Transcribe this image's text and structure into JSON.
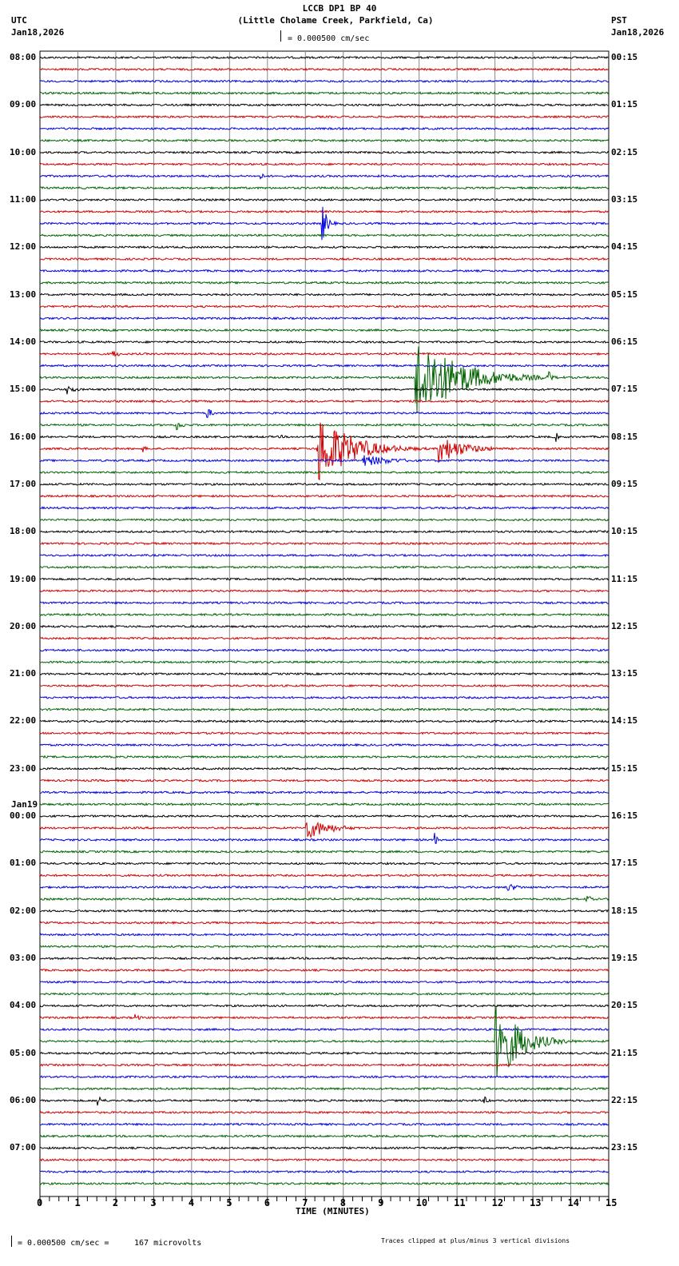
{
  "header": {
    "title": "LCCB DP1 BP 40",
    "subtitle": "(Little Cholame Creek, Parkfield, Ca)",
    "left_tz": "UTC",
    "left_date": "Jan18,2026",
    "right_tz": "PST",
    "right_date": "Jan18,2026",
    "scale": "= 0.000500 cm/sec"
  },
  "footer": {
    "scale": "= 0.000500 cm/sec =",
    "microvolts": "167 microvolts",
    "clip_note": "Traces clipped at plus/minus 3 vertical divisions"
  },
  "chart_data": {
    "type": "line",
    "title": "LCCB DP1 BP 40",
    "xlabel": "TIME (MINUTES)",
    "xlim": [
      0,
      15
    ],
    "x_ticks": [
      "0",
      "1",
      "2",
      "3",
      "4",
      "5",
      "6",
      "7",
      "8",
      "9",
      "10",
      "11",
      "12",
      "13",
      "14",
      "15"
    ],
    "trace_count": 96,
    "trace_minutes": 15,
    "trace_colors": [
      "#000000",
      "#d00000",
      "#0000e0",
      "#006400"
    ],
    "clip_divisions": 3,
    "date_change_label": "Jan19",
    "date_change_trace": 64,
    "left_labels": [
      "08:00",
      "09:00",
      "10:00",
      "11:00",
      "12:00",
      "13:00",
      "14:00",
      "15:00",
      "16:00",
      "17:00",
      "18:00",
      "19:00",
      "20:00",
      "21:00",
      "22:00",
      "23:00",
      "00:00",
      "01:00",
      "02:00",
      "03:00",
      "04:00",
      "05:00",
      "06:00",
      "07:00"
    ],
    "right_labels": [
      "00:15",
      "01:15",
      "02:15",
      "03:15",
      "04:15",
      "05:15",
      "06:15",
      "07:15",
      "08:15",
      "09:15",
      "10:15",
      "11:15",
      "12:15",
      "13:15",
      "14:15",
      "15:15",
      "16:15",
      "17:15",
      "18:15",
      "19:15",
      "20:15",
      "21:15",
      "22:15",
      "23:15"
    ],
    "events": [
      {
        "trace": 14,
        "minute": 7.4,
        "duration": 0.4,
        "amplitude": 1.8
      },
      {
        "trace": 10,
        "minute": 5.8,
        "duration": 0.3,
        "amplitude": 0.3
      },
      {
        "trace": 25,
        "minute": 1.9,
        "duration": 0.6,
        "amplitude": 0.3
      },
      {
        "trace": 27,
        "minute": 9.9,
        "duration": 3.2,
        "amplitude": 3.0
      },
      {
        "trace": 27,
        "minute": 13.4,
        "duration": 0.3,
        "amplitude": 0.6
      },
      {
        "trace": 28,
        "minute": 0.7,
        "duration": 0.6,
        "amplitude": 0.4
      },
      {
        "trace": 30,
        "minute": 4.4,
        "duration": 0.3,
        "amplitude": 0.6
      },
      {
        "trace": 31,
        "minute": 3.6,
        "duration": 0.5,
        "amplitude": 0.4
      },
      {
        "trace": 32,
        "minute": 6.3,
        "duration": 0.2,
        "amplitude": 0.4
      },
      {
        "trace": 32,
        "minute": 13.6,
        "duration": 0.2,
        "amplitude": 0.4
      },
      {
        "trace": 33,
        "minute": 7.3,
        "duration": 2.5,
        "amplitude": 2.5
      },
      {
        "trace": 33,
        "minute": 10.5,
        "duration": 2.0,
        "amplitude": 1.0
      },
      {
        "trace": 33,
        "minute": 2.7,
        "duration": 0.3,
        "amplitude": 0.3
      },
      {
        "trace": 34,
        "minute": 8.5,
        "duration": 2.5,
        "amplitude": 0.4
      },
      {
        "trace": 65,
        "minute": 7.0,
        "duration": 1.8,
        "amplitude": 0.8
      },
      {
        "trace": 66,
        "minute": 10.4,
        "duration": 0.2,
        "amplitude": 0.6
      },
      {
        "trace": 70,
        "minute": 12.3,
        "duration": 1.0,
        "amplitude": 0.3
      },
      {
        "trace": 71,
        "minute": 14.4,
        "duration": 0.3,
        "amplitude": 0.5
      },
      {
        "trace": 81,
        "minute": 2.5,
        "duration": 0.4,
        "amplitude": 0.3
      },
      {
        "trace": 83,
        "minute": 12.0,
        "duration": 1.8,
        "amplitude": 3.0
      },
      {
        "trace": 88,
        "minute": 1.5,
        "duration": 0.4,
        "amplitude": 0.5
      },
      {
        "trace": 88,
        "minute": 11.7,
        "duration": 0.5,
        "amplitude": 0.3
      }
    ]
  }
}
